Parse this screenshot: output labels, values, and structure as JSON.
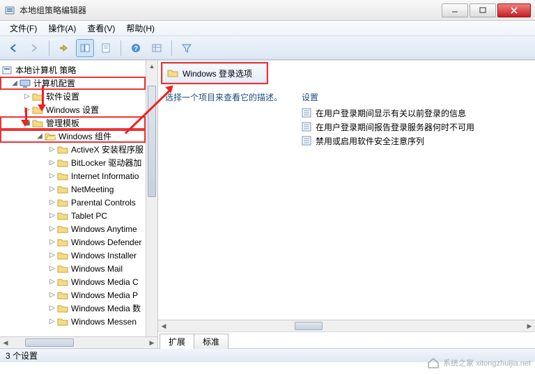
{
  "window": {
    "title": "本地组策略编辑器"
  },
  "menu": {
    "file": "文件(F)",
    "action": "操作(A)",
    "view": "查看(V)",
    "help": "帮助(H)"
  },
  "tree": {
    "root": "本地计算机 策略",
    "n1": "计算机配置",
    "n1_1": "软件设置",
    "n1_2": "Windows 设置",
    "n1_3": "管理模板",
    "n1_3_1": "Windows 组件",
    "children": {
      "c0": "ActiveX 安装程序服",
      "c1": "BitLocker 驱动器加",
      "c2": "Internet Informatio",
      "c3": "NetMeeting",
      "c4": "Parental Controls",
      "c5": "Tablet PC",
      "c6": "Windows Anytime",
      "c7": "Windows Defender",
      "c8": "Windows Installer",
      "c9": "Windows Mail",
      "c10": "Windows Media C",
      "c11": "Windows Media P",
      "c12": "Windows Media 数",
      "c13": "Windows Messen"
    }
  },
  "header": {
    "title": "Windows 登录选项"
  },
  "left_col_hint": "选择一个项目来查看它的描述。",
  "setting_col_label": "设置",
  "settings": {
    "s0": "在用户登录期间显示有关以前登录的信息",
    "s1": "在用户登录期间报告登录服务器何时不可用",
    "s2": "禁用或启用软件安全注意序列"
  },
  "tabs": {
    "extended": "扩展",
    "standard": "标准"
  },
  "status": "3 个设置",
  "watermark": "系统之家 xitongzhuijia.net"
}
